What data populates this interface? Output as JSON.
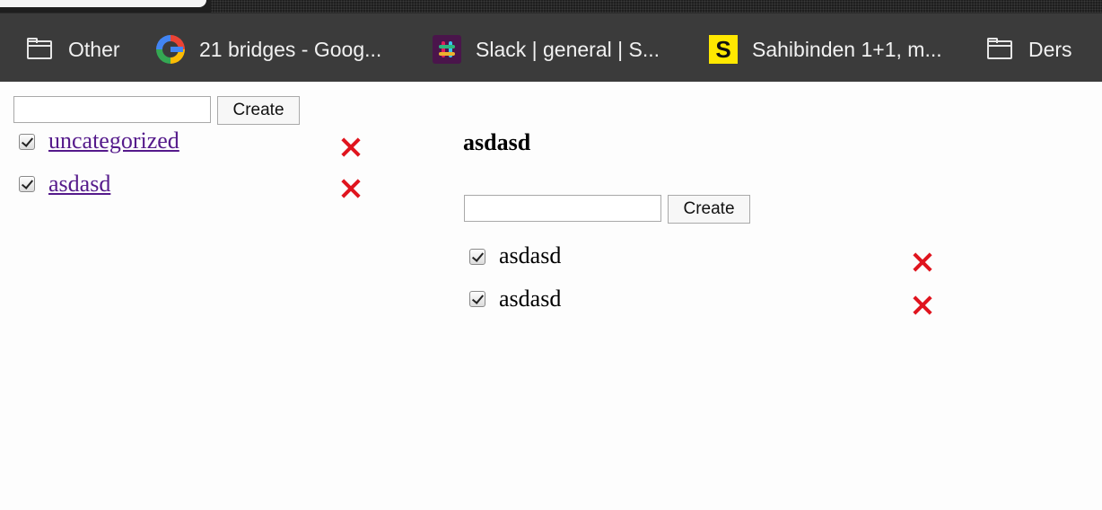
{
  "bookmarks": [
    {
      "label": "Other",
      "icon": "folder-icon"
    },
    {
      "label": "21 bridges - Goog...",
      "icon": "google-icon"
    },
    {
      "label": "Slack | general | S...",
      "icon": "slack-icon"
    },
    {
      "label": "Sahibinden 1+1, m...",
      "icon": "sahibinden-icon",
      "icon_text": "S"
    },
    {
      "label": "Ders",
      "icon": "folder-icon"
    }
  ],
  "categories": {
    "input_value": "",
    "create_label": "Create",
    "items": [
      {
        "label": "uncategorized",
        "checked": true
      },
      {
        "label": "asdasd",
        "checked": true
      }
    ]
  },
  "detail": {
    "title": "asdasd",
    "input_value": "",
    "create_label": "Create",
    "items": [
      {
        "label": "asdasd",
        "checked": true
      },
      {
        "label": "asdasd",
        "checked": true
      }
    ]
  },
  "colors": {
    "delete": "#e0141e",
    "link": "#551a8b",
    "bookmark_bar": "#3b3b3b"
  }
}
